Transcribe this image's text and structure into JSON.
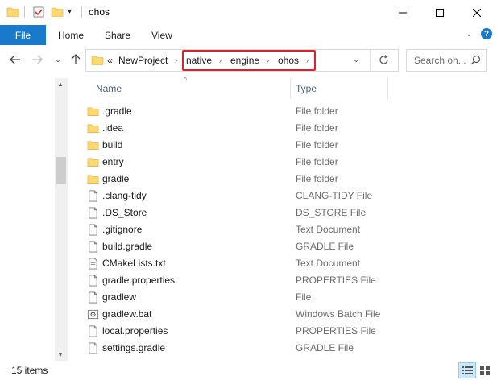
{
  "window": {
    "title": "ohos"
  },
  "ribbon": {
    "tabs": [
      "File",
      "Home",
      "Share",
      "View"
    ]
  },
  "address": {
    "overflow": "«",
    "crumbs": [
      "NewProject",
      "native",
      "engine",
      "ohos"
    ],
    "search_placeholder": "Search oh..."
  },
  "columns": {
    "name": "Name",
    "type": "Type"
  },
  "files": [
    {
      "name": ".gradle",
      "type": "File folder",
      "icon": "folder-icon"
    },
    {
      "name": ".idea",
      "type": "File folder",
      "icon": "folder-icon"
    },
    {
      "name": "build",
      "type": "File folder",
      "icon": "folder-icon"
    },
    {
      "name": "entry",
      "type": "File folder",
      "icon": "folder-icon"
    },
    {
      "name": "gradle",
      "type": "File folder",
      "icon": "folder-icon"
    },
    {
      "name": ".clang-tidy",
      "type": "CLANG-TIDY File",
      "icon": "file-icon"
    },
    {
      "name": ".DS_Store",
      "type": "DS_STORE File",
      "icon": "file-icon"
    },
    {
      "name": ".gitignore",
      "type": "Text Document",
      "icon": "file-icon"
    },
    {
      "name": "build.gradle",
      "type": "GRADLE File",
      "icon": "file-icon"
    },
    {
      "name": "CMakeLists.txt",
      "type": "Text Document",
      "icon": "text-file-icon"
    },
    {
      "name": "gradle.properties",
      "type": "PROPERTIES File",
      "icon": "file-icon"
    },
    {
      "name": "gradlew",
      "type": "File",
      "icon": "file-icon"
    },
    {
      "name": "gradlew.bat",
      "type": "Windows Batch File",
      "icon": "batch-file-icon"
    },
    {
      "name": "local.properties",
      "type": "PROPERTIES File",
      "icon": "file-icon"
    },
    {
      "name": "settings.gradle",
      "type": "GRADLE File",
      "icon": "file-icon"
    }
  ],
  "status": {
    "item_count": "15 items"
  },
  "colors": {
    "accent": "#1979ca",
    "highlight": "#d6242e",
    "folder": "#ffd86e"
  }
}
